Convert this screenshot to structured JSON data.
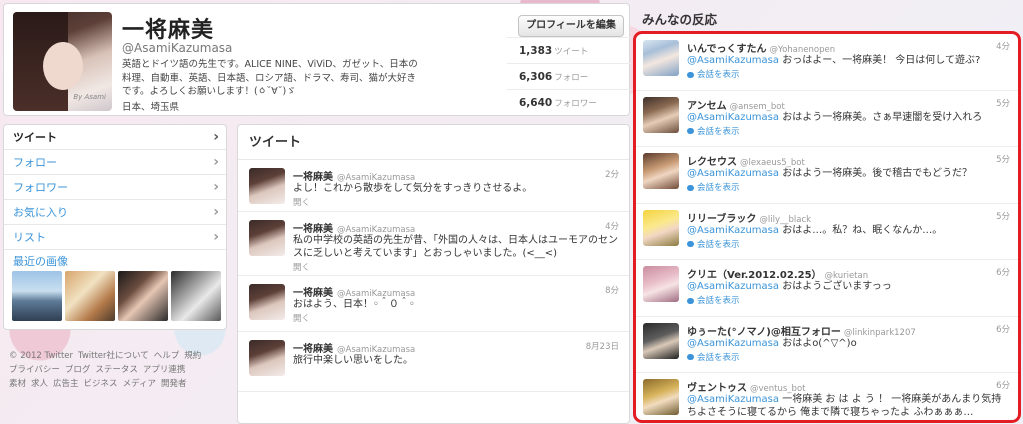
{
  "profile": {
    "name": "一将麻美",
    "handle": "@AsamiKazumasa",
    "bio": "英語とドイツ語の先生です。ALICE NINE、ViViD、ガゼット、日本の料理、自動車、英語、日本語、ロシア語、ドラマ、寿司、猫が大好きです。よろしくお願いします！(ㆁ˘∀˘)ゞ",
    "location": "日本、埼玉県",
    "edit_button": "プロフィールを編集",
    "avatar_signature": "By Asami",
    "stats": [
      {
        "count": "1,383",
        "label": "ツイート"
      },
      {
        "count": "6,306",
        "label": "フォロー"
      },
      {
        "count": "6,640",
        "label": "フォロワー"
      }
    ]
  },
  "nav": {
    "items": [
      {
        "label": "ツイート"
      },
      {
        "label": "フォロー"
      },
      {
        "label": "フォロワー"
      },
      {
        "label": "お気に入り"
      },
      {
        "label": "リスト"
      }
    ],
    "images_label": "最近の画像"
  },
  "footer": {
    "links": [
      "© 2012 Twitter",
      "Twitter社について",
      "ヘルプ",
      "規約",
      "プライバシー",
      "ブログ",
      "ステータス",
      "アプリ連携",
      "素材",
      "求人",
      "広告主",
      "ビジネス",
      "メディア",
      "開発者"
    ]
  },
  "timeline": {
    "title": "ツイート",
    "open_label": "開く",
    "tweets": [
      {
        "name": "一将麻美",
        "handle": "@AsamiKazumasa",
        "time": "2分",
        "text": "よし！これから散歩をして気分をすっきりさせるよ。"
      },
      {
        "name": "一将麻美",
        "handle": "@AsamiKazumasa",
        "time": "4分",
        "text": "私の中学校の英語の先生が昔、「外国の人々は、日本人はユーモアのセンスに乏しいと考えています」とおっしゃいました。(<__<)"
      },
      {
        "name": "一将麻美",
        "handle": "@AsamiKazumasa",
        "time": "8分",
        "text": "おはよう、日本！◦＾０＾◦"
      },
      {
        "name": "一将麻美",
        "handle": "@AsamiKazumasa",
        "time": "8月23日",
        "text": "旅行中楽しい思いをした。"
      }
    ]
  },
  "reactions": {
    "title": "みんなの反応",
    "conversation_label": "会話を表示",
    "items": [
      {
        "name": "いんでっくすたん",
        "handle": "@Yohanenopen",
        "time": "4分",
        "mention": "@AsamiKazumasa",
        "text": " おっはよー、一将麻美！ 今日は何して遊ぶ?"
      },
      {
        "name": "アンセム",
        "handle": "@ansem_bot",
        "time": "5分",
        "mention": "@AsamiKazumasa",
        "text": " おはよう一将麻美。さぁ早速闇を受け入れろ"
      },
      {
        "name": "レクセウス",
        "handle": "@lexaeus5_bot",
        "time": "5分",
        "mention": "@AsamiKazumasa",
        "text": " おはよう一将麻美。後で稽古でもどうだ？"
      },
      {
        "name": "リリーブラック",
        "handle": "@lily__black",
        "time": "5分",
        "mention": "@AsamiKazumasa",
        "text": " おはよ…。私？ね、眠くなんか…。"
      },
      {
        "name": "クリエ（Ver.2012.02.25）",
        "handle": "@kurietan",
        "time": "6分",
        "mention": "@AsamiKazumasa",
        "text": " おはようございますっっ"
      },
      {
        "name": "ゆぅーた(°ノマノ)@相互フォロー",
        "handle": "@linkinpark1207",
        "time": "6分",
        "mention": "@AsamiKazumasa",
        "text": " おはよo(^▽^)o"
      },
      {
        "name": "ヴェントゥス",
        "handle": "@ventus_bot",
        "time": "6分",
        "mention": "@AsamiKazumasa",
        "text": " 一将麻美 お は よ う ！ 一将麻美があんまり気持ちよさそうに寝てるから 俺まで隣で寝ちゃったよ ふわぁぁぁ…"
      }
    ]
  }
}
